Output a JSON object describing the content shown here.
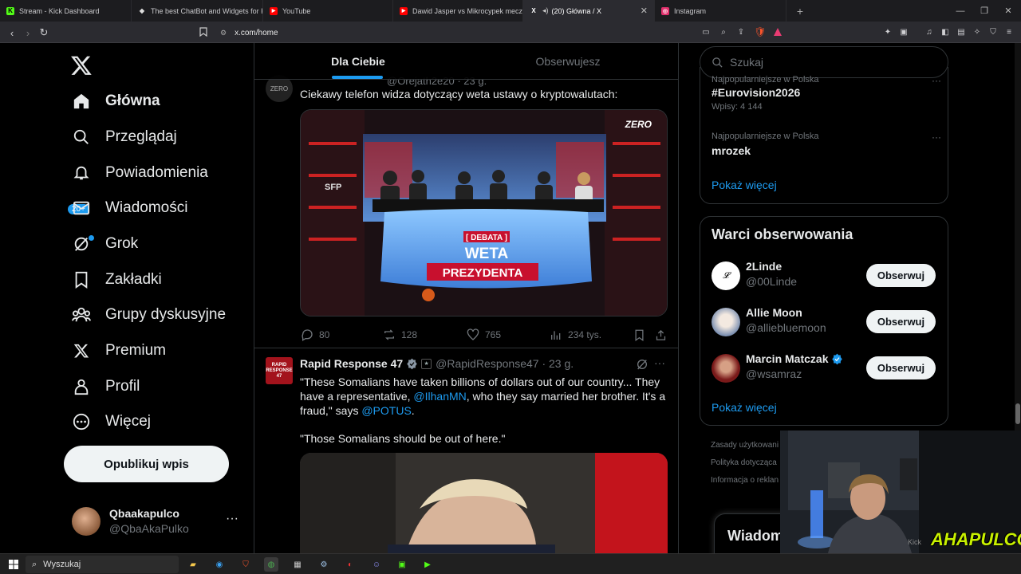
{
  "browser": {
    "tabs": [
      {
        "title": "Stream - Kick Dashboard",
        "color": "#53fc18",
        "glyph": "K"
      },
      {
        "title": "The best ChatBot and Widgets for Ki",
        "color": "#cccccc",
        "glyph": "◆"
      },
      {
        "title": "YouTube",
        "color": "#ff0000",
        "glyph": "▶"
      },
      {
        "title": "Dawid Jasper vs Mikrocypek mecz o",
        "color": "#ff0000",
        "glyph": "▶"
      },
      {
        "title": "(20) Główna / X",
        "color": "#ffffff",
        "glyph": "X"
      },
      {
        "title": "Instagram",
        "color": "#e1306c",
        "glyph": "◎"
      }
    ],
    "url": "x.com/home"
  },
  "nav": {
    "items": [
      {
        "label": "Główna",
        "icon": "home-icon"
      },
      {
        "label": "Przeglądaj",
        "icon": "search-icon"
      },
      {
        "label": "Powiadomienia",
        "icon": "bell-icon"
      },
      {
        "label": "Wiadomości",
        "icon": "mail-icon"
      },
      {
        "label": "Grok",
        "icon": "grok-icon"
      },
      {
        "label": "Zakładki",
        "icon": "bookmark-icon"
      },
      {
        "label": "Grupy dyskusyjne",
        "icon": "groups-icon"
      },
      {
        "label": "Premium",
        "icon": "x-icon"
      },
      {
        "label": "Profil",
        "icon": "person-icon"
      },
      {
        "label": "Więcej",
        "icon": "more-circle-icon"
      }
    ],
    "notification_badge": "20+",
    "post_label": "Opublikuj wpis",
    "profile": {
      "name": "Qbaakapulco",
      "handle": "@QbaAkaPulko"
    }
  },
  "feed": {
    "tabs": [
      "Dla Ciebie",
      "Obserwujesz"
    ],
    "tweet1": {
      "partial_header": "@Orejath2e20 · 23 g.",
      "text": "Ciekawy telefon widza dotyczący weta ustawy o kryptowalutach:",
      "image": {
        "logo": "ZERO",
        "banner_top": "[ DEBATA ]",
        "banner_mid": "WETA",
        "banner_bottom": "PREZYDENTA",
        "side": "SFP"
      },
      "replies": "80",
      "reposts": "128",
      "likes": "765",
      "views": "234 tys."
    },
    "tweet2": {
      "name": "Rapid Response 47",
      "handle": "@RapidResponse47 · 23 g.",
      "avatar_text": "RAPID RESPONSE 47",
      "text_a": "\"These Somalians have taken billions of dollars out of our country... They have a representative, ",
      "mention_a": "@IlhanMN",
      "text_b": ", who they say married her brother. It's a fraud,\" says ",
      "mention_b": "@POTUS",
      "text_c": ".",
      "quote": "\"Those Somalians should be out of here.\""
    }
  },
  "right": {
    "search_placeholder": "Szukaj",
    "trends": [
      {
        "context": "Najpopularniejsze w Polska",
        "name": "#Eurovision2026",
        "count": "Wpisy: 4 144"
      },
      {
        "context": "Najpopularniejsze w Polska",
        "name": "mrozek",
        "count": ""
      }
    ],
    "show_more": "Pokaż więcej",
    "who_to_follow_title": "Warci obserwowania",
    "who_to_follow": [
      {
        "name": "2Linde",
        "handle": "@00Linde",
        "verified": false,
        "avatar_color": "#ffffff"
      },
      {
        "name": "Allie Moon",
        "handle": "@alliebluemoon",
        "verified": false,
        "avatar_color": "#bfc7d6"
      },
      {
        "name": "Marcin Matczak",
        "handle": "@wsamraz",
        "verified": true,
        "avatar_color": "#7a1a1a"
      }
    ],
    "follow_label": "Obserwuj",
    "footer": [
      "Zasady użytkowani",
      "Polityka dotycząca",
      "Informacja o reklan"
    ],
    "messages_label": "Wiadom"
  },
  "webcam": {
    "overlay_text": "AHAPULCO",
    "small_text": "Kick"
  },
  "taskbar": {
    "search_label": "Wyszukaj"
  }
}
